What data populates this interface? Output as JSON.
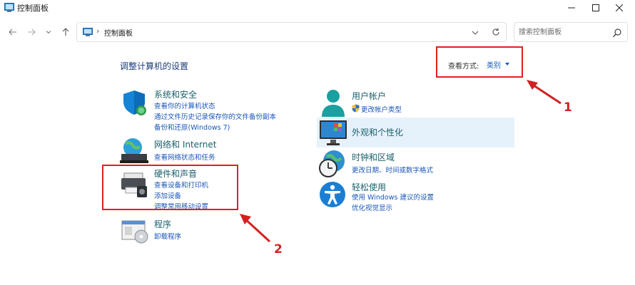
{
  "window": {
    "title": "控制面板"
  },
  "address": {
    "path": "控制面板",
    "separator": "›"
  },
  "search": {
    "placeholder": "搜索控制面板"
  },
  "main": {
    "heading": "调整计算机的设置",
    "view_by_label": "查看方式:",
    "view_by_value": "类别"
  },
  "categories": {
    "system": {
      "title": "系统和安全",
      "links": [
        "查看你的计算机状态",
        "通过文件历史记录保存你的文件备份副本",
        "备份和还原(Windows 7)"
      ]
    },
    "network": {
      "title": "网络和 Internet",
      "links": [
        "查看网络状态和任务"
      ]
    },
    "hardware": {
      "title": "硬件和声音",
      "links": [
        "查看设备和打印机",
        "添加设备",
        "调整常用移动设置"
      ]
    },
    "programs": {
      "title": "程序",
      "links": [
        "卸载程序"
      ]
    },
    "users": {
      "title": "用户帐户",
      "links": [
        "更改帐户类型"
      ]
    },
    "appearance": {
      "title": "外观和个性化",
      "links": []
    },
    "clock": {
      "title": "时钟和区域",
      "links": [
        "更改日期、时间或数字格式"
      ]
    },
    "ease": {
      "title": "轻松使用",
      "links": [
        "使用 Windows 建议的设置",
        "优化视觉显示"
      ]
    }
  },
  "annotations": {
    "label_1": "1",
    "label_2": "2"
  },
  "colors": {
    "accent": "#0a5fbd",
    "annotation": "#e02020",
    "highlight": "#e6f2fb"
  }
}
